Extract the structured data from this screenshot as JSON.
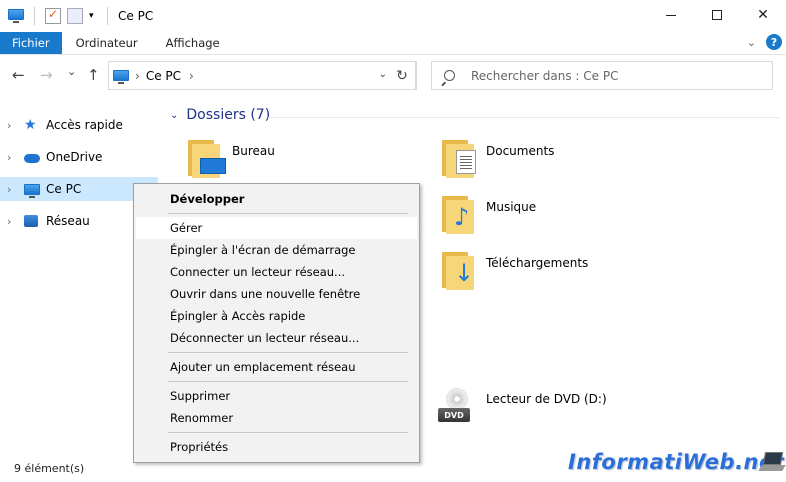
{
  "window": {
    "title": "Ce PC",
    "controls": {
      "minimize": "",
      "maximize": "",
      "close": "✕"
    }
  },
  "ribbon": {
    "tabs": [
      "Fichier",
      "Ordinateur",
      "Affichage"
    ],
    "help": "?"
  },
  "navigation": {
    "back": "←",
    "forward": "→",
    "recent": "⌄",
    "up": "↑",
    "address": {
      "crumb": "Ce PC",
      "separator": "›",
      "dropdown": "⌄"
    },
    "refresh": "↻",
    "search_placeholder": "Rechercher dans : Ce PC"
  },
  "sidebar": {
    "items": [
      {
        "label": "Accès rapide",
        "icon": "star-icon"
      },
      {
        "label": "OneDrive",
        "icon": "cloud-icon"
      },
      {
        "label": "Ce PC",
        "icon": "computer-icon",
        "selected": true
      },
      {
        "label": "Réseau",
        "icon": "network-icon"
      }
    ]
  },
  "main": {
    "group_title": "Dossiers (7)",
    "folders": [
      {
        "label": "Bureau",
        "icon": "desktop-folder-icon"
      },
      {
        "label": "Documents",
        "icon": "documents-folder-icon"
      },
      {
        "label": "Musique",
        "icon": "music-folder-icon"
      },
      {
        "label": "Téléchargements",
        "icon": "downloads-folder-icon"
      }
    ],
    "drive": {
      "label": "Lecteur de DVD (D:)",
      "badge": "DVD"
    }
  },
  "status": {
    "items_count": "9 élément(s)"
  },
  "context_menu": {
    "items": [
      {
        "label": "Développer",
        "bold": true
      },
      {
        "label": "Gérer",
        "hover": true
      },
      {
        "label": "Épingler à l'écran de démarrage"
      },
      {
        "label": "Connecter un lecteur réseau..."
      },
      {
        "label": "Ouvrir dans une nouvelle fenêtre"
      },
      {
        "label": "Épingler à Accès rapide"
      },
      {
        "label": "Déconnecter un lecteur réseau..."
      },
      {
        "label": "Ajouter un emplacement réseau"
      },
      {
        "label": "Supprimer"
      },
      {
        "label": "Renommer"
      },
      {
        "label": "Propriétés"
      }
    ]
  },
  "watermark": {
    "text": "InformatiWeb.net"
  },
  "colors": {
    "accent": "#1979ca",
    "selection": "#cce8ff",
    "group_title": "#1e3287",
    "folder": "#f7d67a"
  }
}
